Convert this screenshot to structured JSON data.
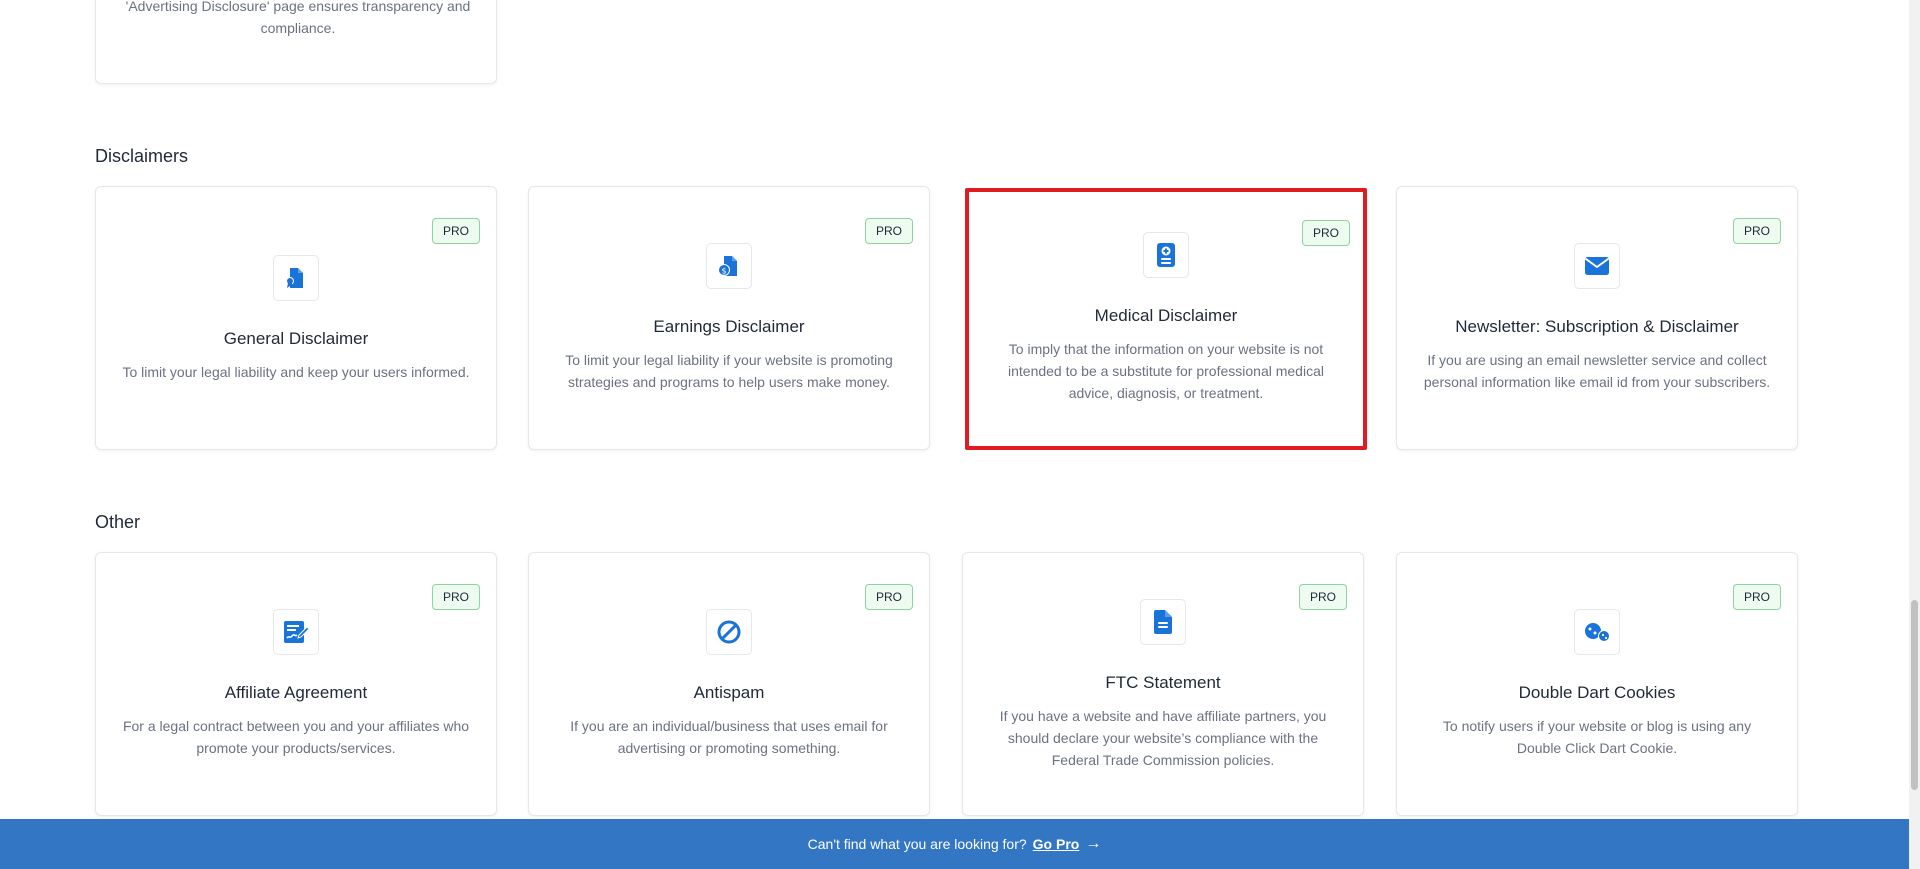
{
  "partial_card": {
    "text_line1": "'Advertising Disclosure' page ensures transparency and",
    "text_line2": "compliance."
  },
  "sections": {
    "disclaimers": "Disclaimers",
    "other": "Other"
  },
  "cards": {
    "general_disclaimer": {
      "badge": "PRO",
      "title": "General Disclaimer",
      "desc": "To limit your legal liability and keep your users informed."
    },
    "earnings_disclaimer": {
      "badge": "PRO",
      "title": "Earnings Disclaimer",
      "desc": "To limit your legal liability if your website is promoting strategies and programs to help users make money."
    },
    "medical_disclaimer": {
      "badge": "PRO",
      "title": "Medical Disclaimer",
      "desc": "To imply that the information on your website is not intended to be a substitute for professional medical advice, diagnosis, or treatment."
    },
    "newsletter": {
      "badge": "PRO",
      "title": "Newsletter: Subscription & Disclaimer",
      "desc": "If you are using an email newsletter service and collect personal information like email id from your subscribers."
    },
    "affiliate_agreement": {
      "badge": "PRO",
      "title": "Affiliate Agreement",
      "desc": "For a legal contract between you and your affiliates who promote your products/services."
    },
    "antispam": {
      "badge": "PRO",
      "title": "Antispam",
      "desc": "If you are an individual/business that uses email for advertising or promoting something."
    },
    "ftc_statement": {
      "badge": "PRO",
      "title": "FTC Statement",
      "desc": "If you have a website and have affiliate partners, you should declare your website’s compliance with the Federal Trade Commission policies."
    },
    "double_dart": {
      "badge": "PRO",
      "title": "Double Dart Cookies",
      "desc": "To notify users if your website or blog is using any Double Click Dart Cookie."
    }
  },
  "bottom_bar": {
    "text": "Can't find what you are looking for?",
    "link": "Go Pro",
    "arrow": "→"
  },
  "colors": {
    "accent": "#1a73d9",
    "selected_border": "#e01b22",
    "bottom_bar": "#3376c4",
    "badge_bg": "#eefbf1",
    "badge_border": "#8fd3a2"
  },
  "icons": {
    "general_disclaimer": "document-ribbon-icon",
    "earnings_disclaimer": "document-dollar-icon",
    "medical_disclaimer": "medical-document-icon",
    "newsletter": "envelope-icon",
    "affiliate_agreement": "contract-sign-icon",
    "antispam": "ban-icon",
    "ftc_statement": "document-lines-icon",
    "double_dart": "cookies-icon"
  }
}
